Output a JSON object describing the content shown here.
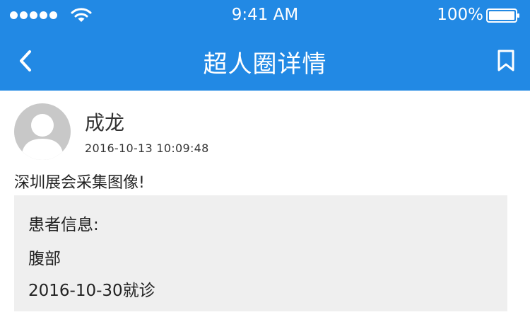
{
  "status_bar": {
    "time": "9:41 AM",
    "battery": "100%",
    "signal_icon": "signal-dots-icon",
    "wifi_icon": "wifi-icon",
    "battery_icon": "battery-icon"
  },
  "nav": {
    "title": "超人圈详情",
    "back_icon": "chevron-left-icon",
    "bookmark_icon": "bookmark-icon"
  },
  "post": {
    "author": "成龙",
    "timestamp": "2016-10-13  10:09:48",
    "text": "深圳展会采集图像!",
    "avatar_icon": "default-avatar-icon",
    "info": {
      "title": "患者信息:",
      "body_part": "腹部",
      "visit": "2016-10-30就诊"
    }
  },
  "colors": {
    "header_bg": "#2289e4",
    "card_bg": "#efefef",
    "avatar_bg": "#c8c8c8"
  }
}
